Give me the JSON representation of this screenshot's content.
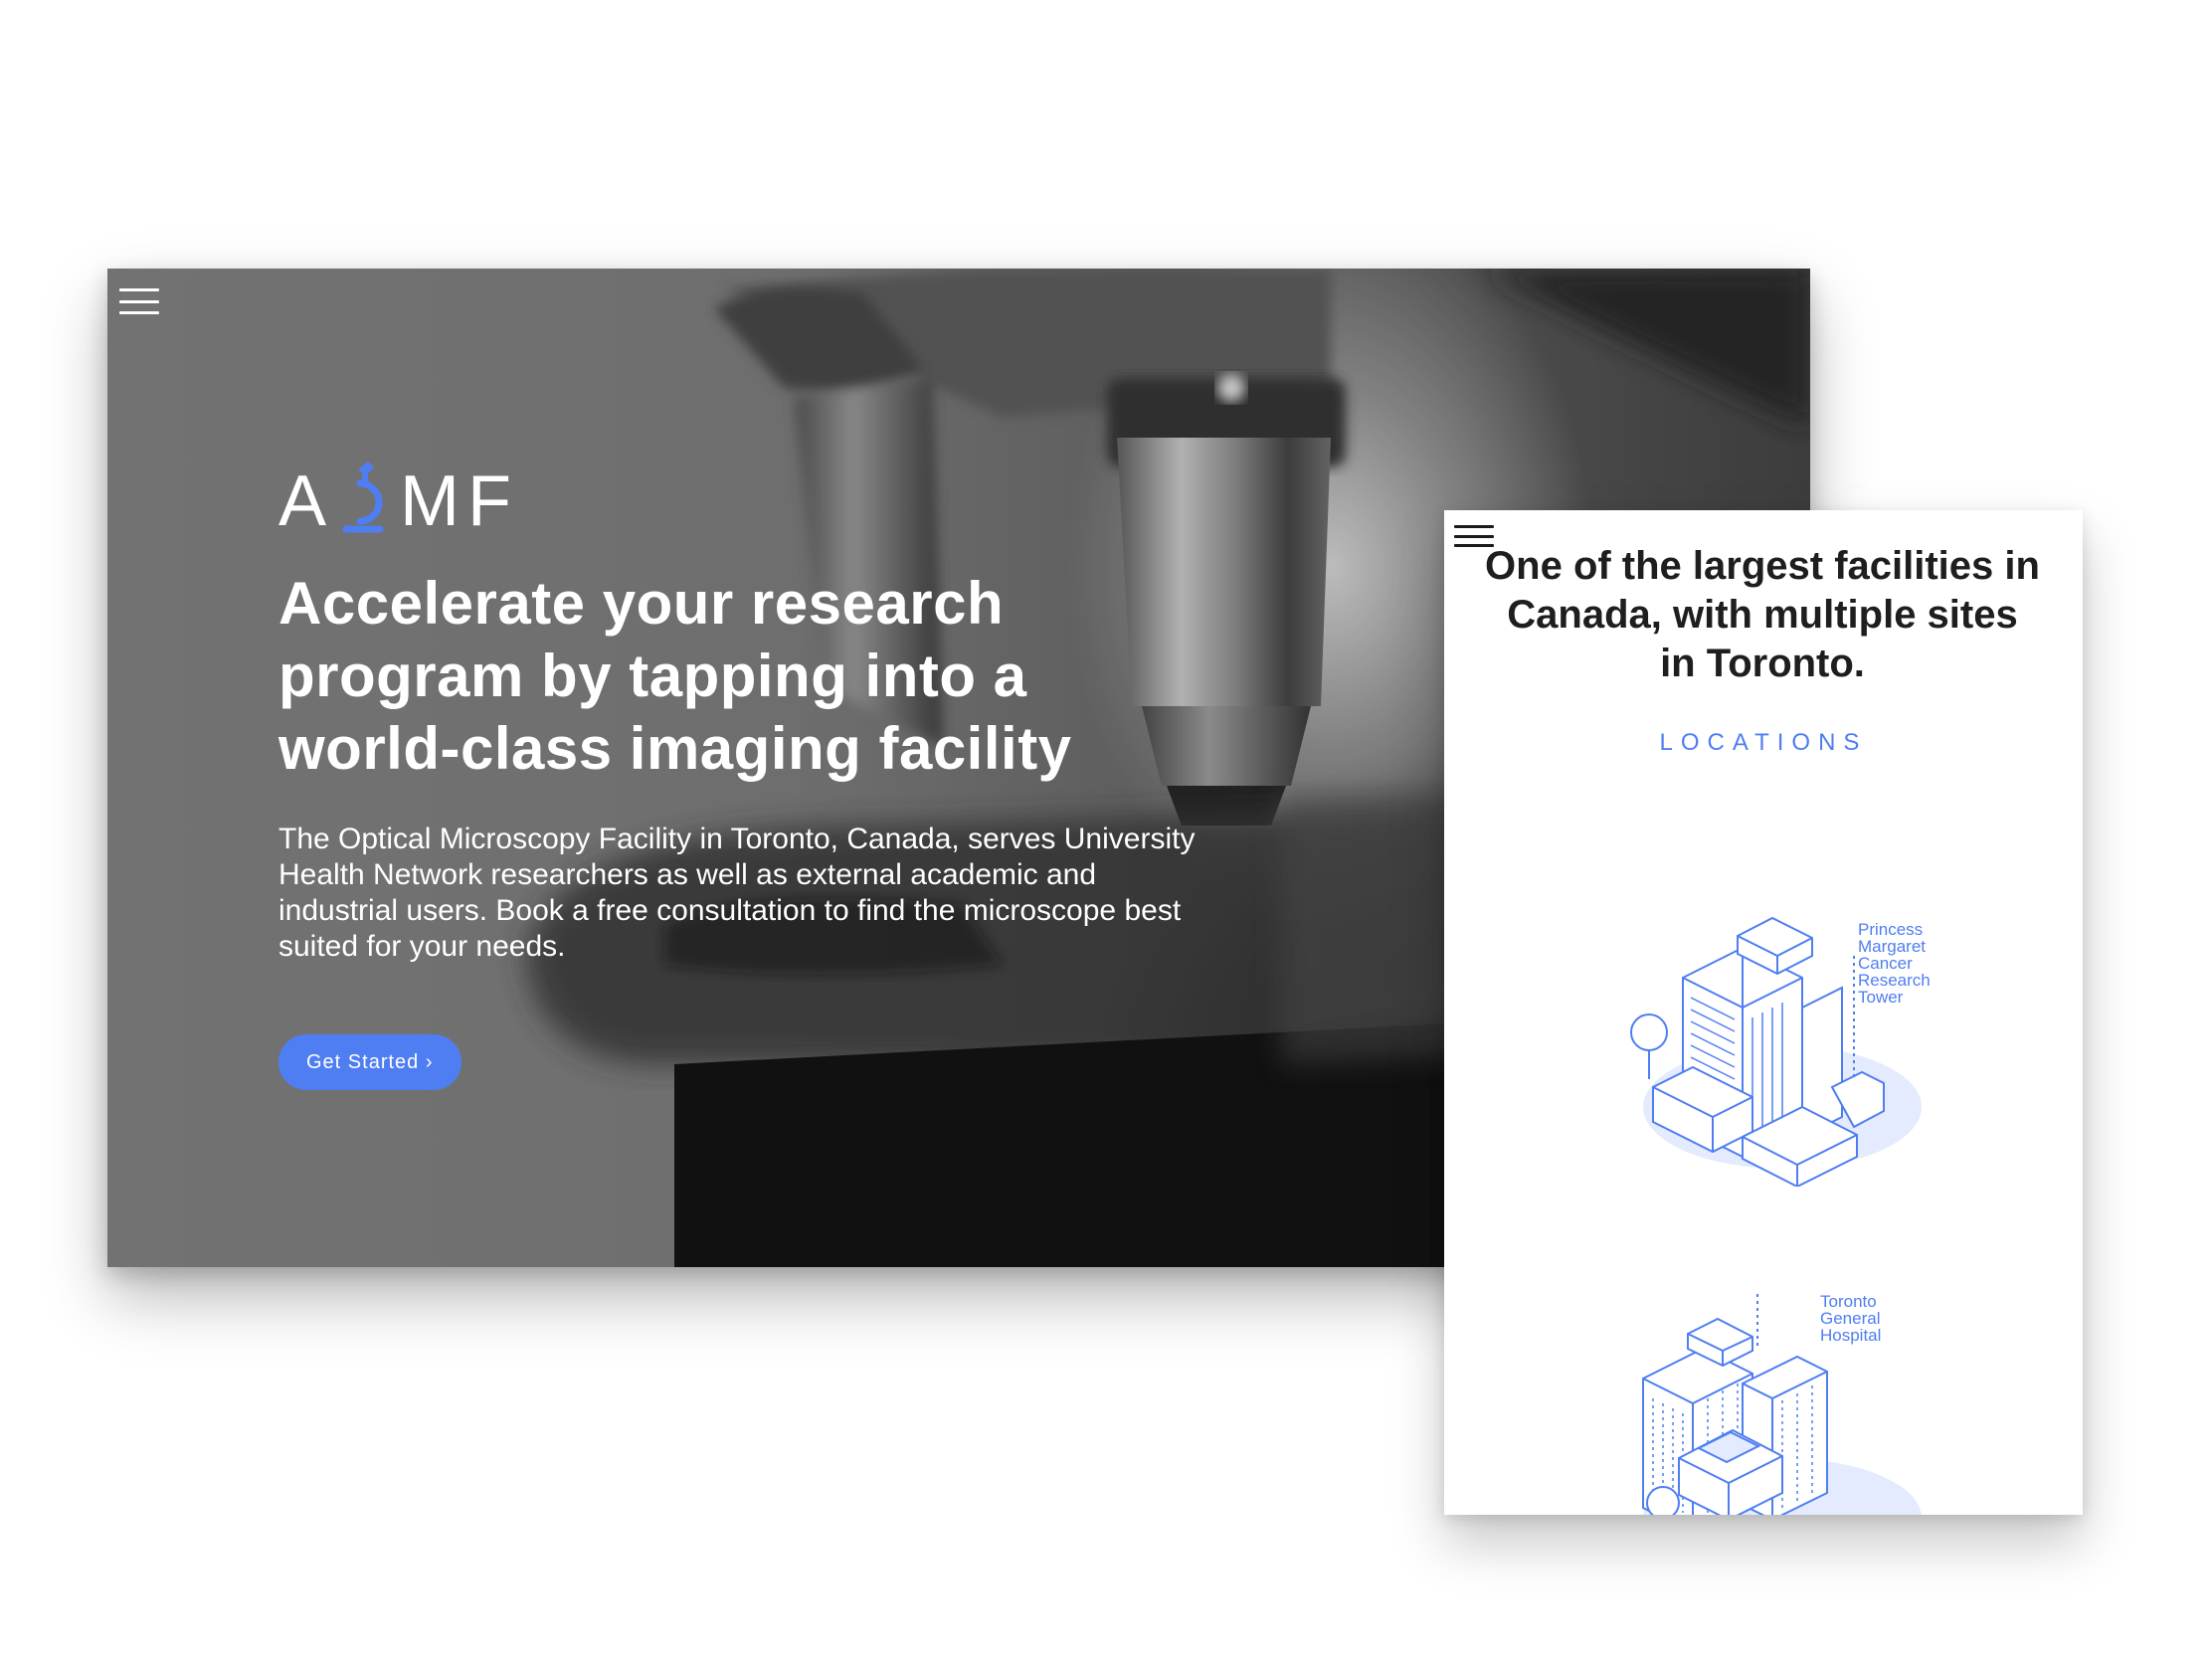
{
  "desktop": {
    "logo": {
      "left": "A",
      "right": "MF"
    },
    "hero_title": "Accelerate your research program by tapping into a world-class imaging facility",
    "hero_description": "The Optical Microscopy Facility in Toronto, Canada, serves University Health Network researchers as well as external academic and industrial users. Book a free consultation to find the microscope best suited for your needs.",
    "cta_label": "Get Started ›",
    "menu_icon": "hamburger-menu-icon"
  },
  "mobile": {
    "menu_icon": "hamburger-menu-icon",
    "title": "One of the largest facilities in Canada, with multiple sites in Toronto.",
    "section_label": "LOCATIONS",
    "locations": [
      {
        "label_lines": [
          "Princess",
          "Margaret",
          "Cancer",
          "Research",
          "Tower"
        ],
        "icon": "building-illustration"
      },
      {
        "label_lines": [
          "Toronto",
          "General",
          "Hospital"
        ],
        "icon": "hospital-illustration"
      }
    ]
  },
  "colors": {
    "accent": "#4f7ef2",
    "hero_text": "#ffffff",
    "mobile_title": "#1e1e1e"
  }
}
